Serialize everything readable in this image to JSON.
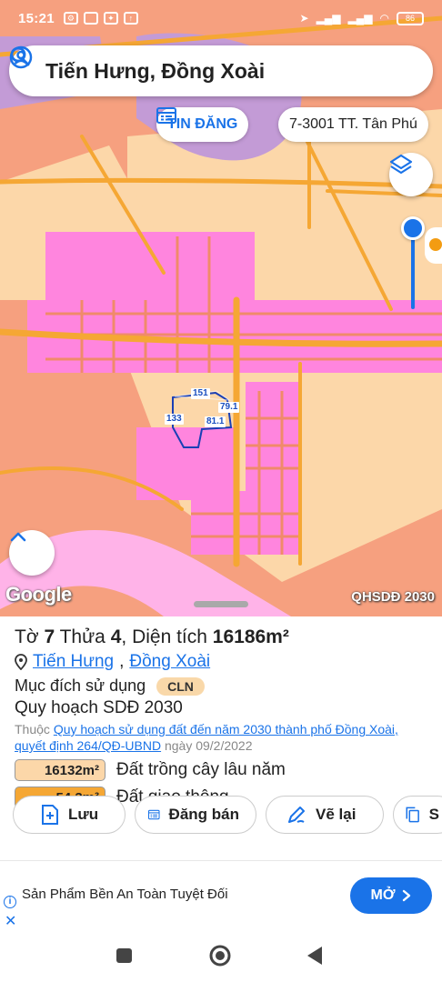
{
  "status_bar": {
    "time": "15:21",
    "battery": "86"
  },
  "search": {
    "title": "Tiến Hưng, Đồng Xoài"
  },
  "chips": {
    "tin_dang": "TIN ĐĂNG",
    "map_sheet": "7-3001 TT. Tân Phú"
  },
  "map": {
    "google": "Google",
    "plan_tag": "QHSDĐ 2030",
    "plot_edges": [
      "151",
      "79.1",
      "133",
      "81.1"
    ]
  },
  "parcel": {
    "to_label": "Tờ",
    "to": "7",
    "thua_label": "Thửa",
    "thua": "4",
    "area_label": "Diện tích",
    "area": "16186m²",
    "ward": "Tiến Hưng",
    "city": "Đồng Xoài",
    "purpose_label": "Mục đích sử dụng",
    "purpose_code": "CLN",
    "plan_label": "Quy hoạch SDĐ 2030",
    "source_prefix": "Thuộc",
    "source_link": "Quy hoạch sử dụng đất đến năm 2030 thành phố Đồng Xoài, quyết định 264/QĐ-UBND",
    "source_date": "ngày 09/2/2022",
    "areas": [
      {
        "value": "16132m²",
        "label": "Đất trồng cây lâu năm",
        "color": "#fcd7a9"
      },
      {
        "value": "54.3m²",
        "label": "Đất giao thông",
        "color": "#f5a734"
      }
    ]
  },
  "actions": {
    "save": "Lưu",
    "post": "Đăng bán",
    "draw": "Vẽ lại",
    "copy": "S"
  },
  "ad": {
    "text": "Sản Phẩm Bền An Toàn Tuyệt Đối",
    "button": "MỞ"
  },
  "colors": {
    "accent": "#1a73e8",
    "residential": "#f6a07f",
    "perennial": "#fcd7a9",
    "transport": "#f5a734",
    "urban": "#ff7fe0",
    "water": "#c39bd6"
  }
}
